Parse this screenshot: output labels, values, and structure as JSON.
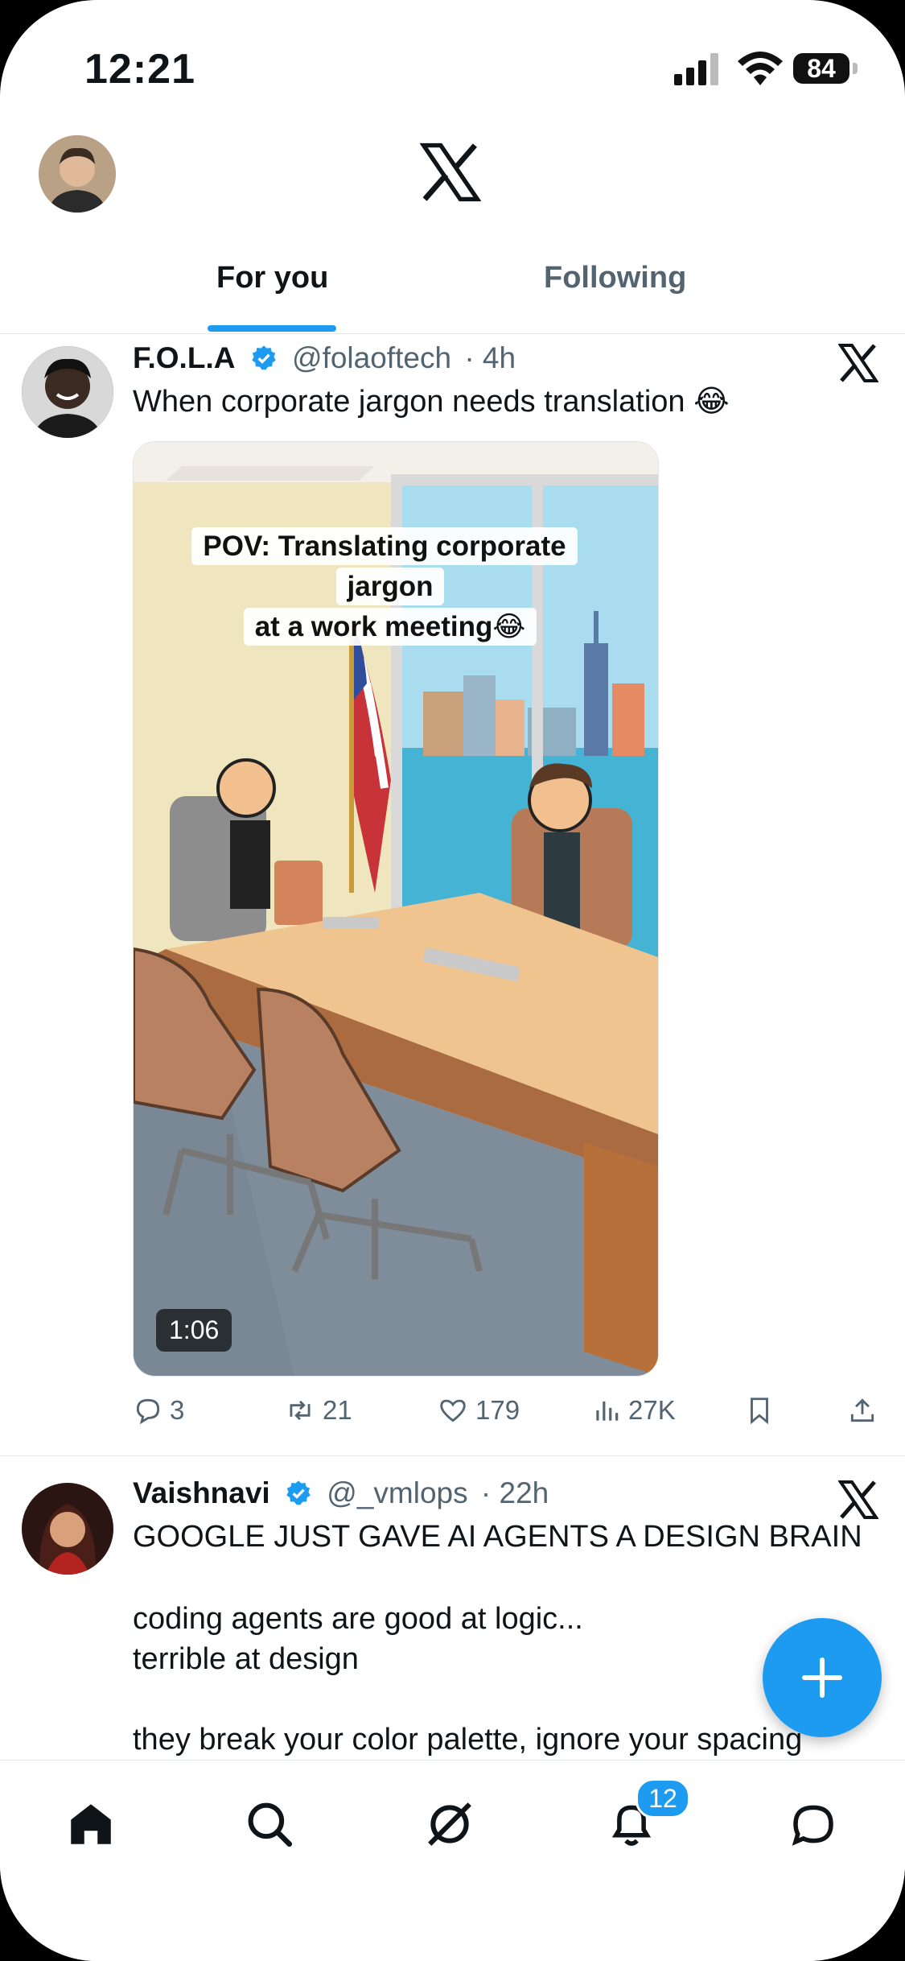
{
  "status_bar": {
    "time": "12:21",
    "battery": "84"
  },
  "header": {
    "tabs": [
      {
        "label": "For you"
      },
      {
        "label": "Following"
      }
    ]
  },
  "posts": [
    {
      "name": "F.O.L.A",
      "handle": "@folaoftech",
      "time": "· 4h",
      "text": "When corporate jargon needs translation 😂",
      "media": {
        "caption_line1": "POV: Translating corporate jargon",
        "caption_line2": "at a work meeting😂",
        "duration": "1:06"
      },
      "stats": {
        "replies": "3",
        "reposts": "21",
        "likes": "179",
        "views": "27K"
      }
    },
    {
      "name": "Vaishnavi",
      "handle": "@_vmlops",
      "time": "· 22h",
      "lines": [
        "GOOGLE JUST GAVE AI AGENTS A DESIGN BRAIN",
        "",
        "coding agents are good at logic...",
        "terrible at design",
        "",
        "they break your color palette, ignore your spacing"
      ]
    }
  ],
  "bottom_nav": {
    "notifications_badge": "12"
  },
  "colors": {
    "accent": "#1d9bf0",
    "text": "#0f1419",
    "secondary": "#536471"
  },
  "icons": [
    "home-icon",
    "search-icon",
    "grok-icon",
    "bell-icon",
    "messages-icon",
    "compose-icon",
    "x-logo-icon"
  ]
}
